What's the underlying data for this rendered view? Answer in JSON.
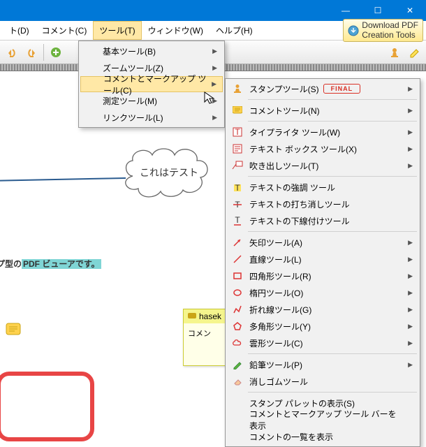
{
  "titlebar": {
    "min": "—",
    "max": "☐",
    "close": "✕"
  },
  "menubar": {
    "items": [
      {
        "label": "ト(D)"
      },
      {
        "label": "コメント(C)"
      },
      {
        "label": "ツール(T)",
        "active": true
      },
      {
        "label": "ウィンドウ(W)"
      },
      {
        "label": "ヘルプ(H)"
      }
    ],
    "download": {
      "line1": "Download PDF",
      "line2": "Creation Tools"
    }
  },
  "submenu1": {
    "items": [
      {
        "label": "基本ツール(B)",
        "arrow": true
      },
      {
        "label": "ズームツール(Z)",
        "arrow": true
      },
      {
        "label": "コメントとマークアップ ツール(C)",
        "arrow": true,
        "hl": true
      },
      {
        "label": "測定ツール(M)",
        "arrow": true
      },
      {
        "label": "リンクツール(L)",
        "arrow": true
      }
    ]
  },
  "submenu2": {
    "groups": [
      [
        {
          "label": "スタンプツール(S)",
          "icon": "stamp",
          "arrow": true,
          "final": true
        }
      ],
      [
        {
          "label": "コメントツール(N)",
          "icon": "note",
          "arrow": true
        }
      ],
      [
        {
          "label": "タイプライタ ツール(W)",
          "icon": "typewriter",
          "arrow": true
        },
        {
          "label": "テキスト ボックス ツール(X)",
          "icon": "textbox",
          "arrow": true
        },
        {
          "label": "吹き出しツール(T)",
          "icon": "callout",
          "arrow": true
        }
      ],
      [
        {
          "label": "テキストの強調 ツール",
          "icon": "highlight"
        },
        {
          "label": "テキストの打ち消しツール",
          "icon": "strike"
        },
        {
          "label": "テキストの下線付けツール",
          "icon": "underline"
        }
      ],
      [
        {
          "label": "矢印ツール(A)",
          "icon": "arrow",
          "arrow": true
        },
        {
          "label": "直線ツール(L)",
          "icon": "line",
          "arrow": true
        },
        {
          "label": "四角形ツール(R)",
          "icon": "rect",
          "arrow": true
        },
        {
          "label": "楕円ツール(O)",
          "icon": "oval",
          "arrow": true
        },
        {
          "label": "折れ線ツール(G)",
          "icon": "polyline",
          "arrow": true
        },
        {
          "label": "多角形ツール(Y)",
          "icon": "polygon",
          "arrow": true
        },
        {
          "label": "雲形ツール(C)",
          "icon": "cloud",
          "arrow": true
        }
      ],
      [
        {
          "label": "鉛筆ツール(P)",
          "icon": "pencil",
          "arrow": true
        },
        {
          "label": "消しゴムツール",
          "icon": "eraser"
        }
      ],
      [
        {
          "label": "スタンプ パレットの表示(S)"
        },
        {
          "label": "コメントとマークアップ ツール バーを表示"
        },
        {
          "label": "コメントの一覧を表示"
        }
      ]
    ]
  },
  "doc": {
    "cloud_text": "これはテスト",
    "desc_prefix": "プ型の",
    "desc_hi": "PDF ビューアです。",
    "sticky_author": "hasek",
    "sticky_body": "コメン",
    "xmark": "、"
  }
}
